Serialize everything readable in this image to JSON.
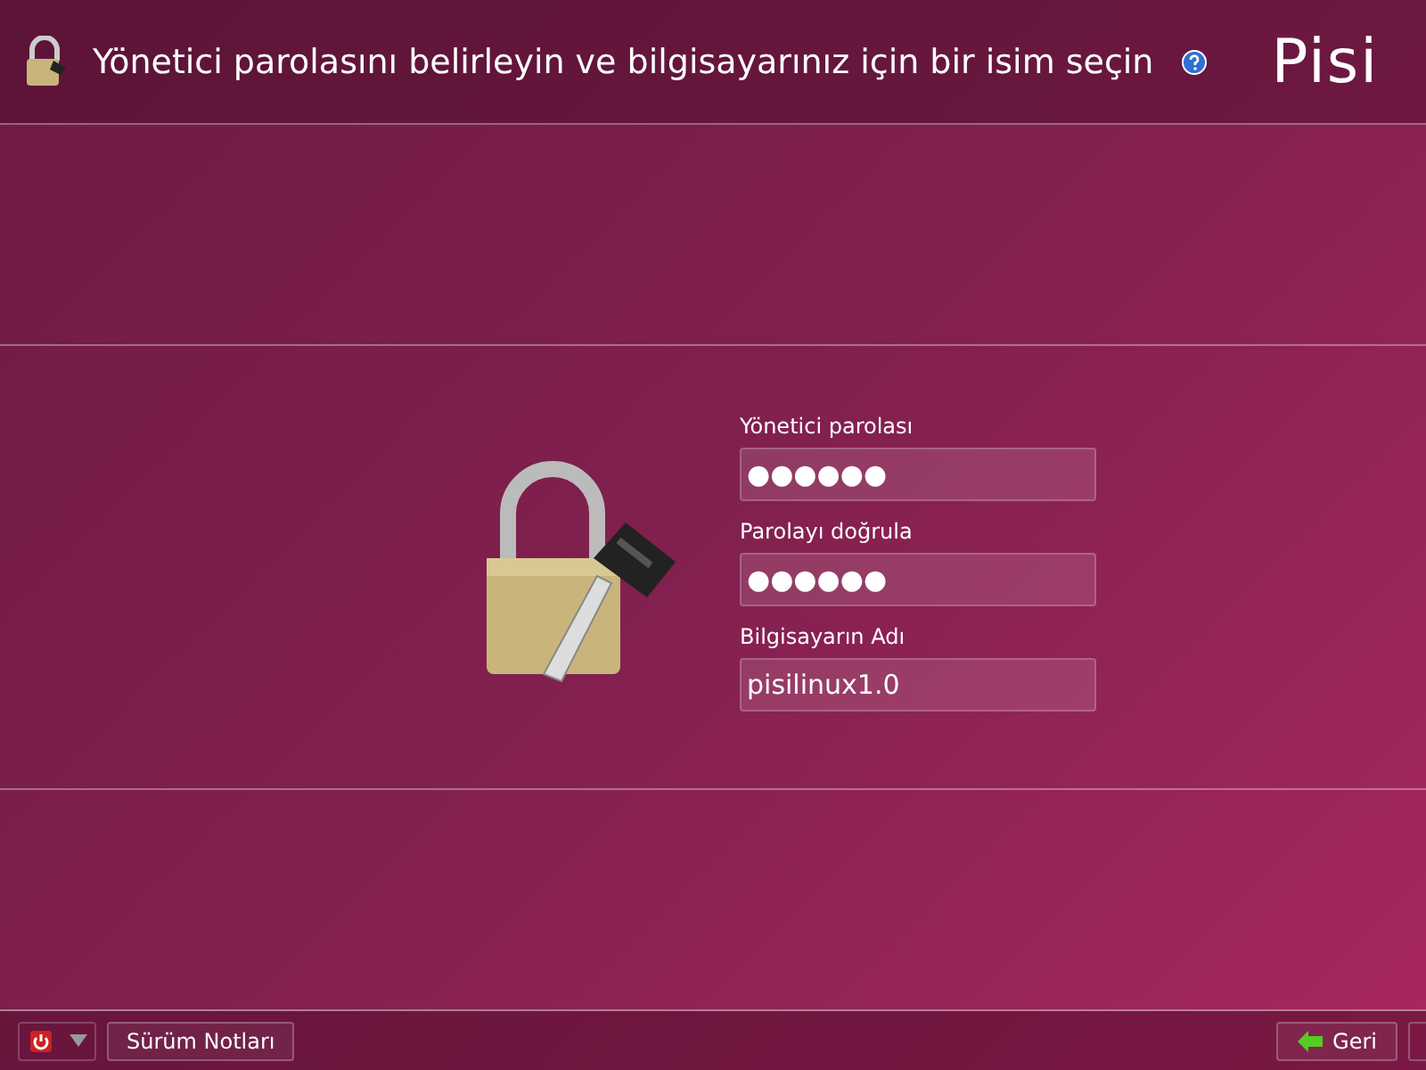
{
  "header": {
    "title": "Yönetici parolasını belirleyin ve bilgisayarınız için bir isim seçin",
    "logo": "Pisi"
  },
  "form": {
    "fields": [
      {
        "label": "Yönetici parolası",
        "value": "●●●●●●"
      },
      {
        "label": "Parolayı doğrula",
        "value": "●●●●●●"
      },
      {
        "label": "Bilgisayarın Adı",
        "value": "pisilinux1.0"
      }
    ]
  },
  "footer": {
    "release_notes": "Sürüm Notları",
    "back": "Geri"
  }
}
